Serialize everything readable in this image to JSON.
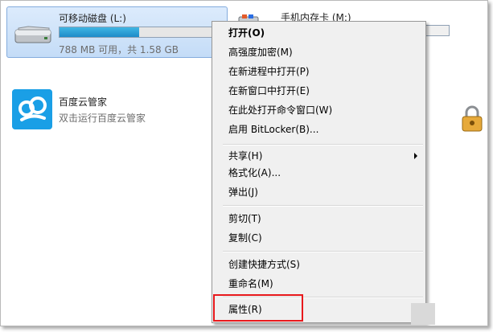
{
  "drive_removable": {
    "name": "可移动磁盘 (L:)",
    "space": "788 MB 可用，共 1.58 GB",
    "used_fraction": 0.5
  },
  "drive_phone": {
    "name": "手机内存卡 (M:)"
  },
  "baidu": {
    "name": "百度云管家",
    "description": "双击运行百度云管家"
  },
  "menu": {
    "open": "打开(O)",
    "encrypt": "高强度加密(M)",
    "open_new_process": "在新进程中打开(P)",
    "open_new_window": "在新窗口中打开(E)",
    "open_cmd": "在此处打开命令窗口(W)",
    "bitlocker": "启用 BitLocker(B)...",
    "share": "共享(H)",
    "format": "格式化(A)...",
    "eject": "弹出(J)",
    "cut": "剪切(T)",
    "copy": "复制(C)",
    "create_shortcut": "创建快捷方式(S)",
    "rename": "重命名(M)",
    "properties": "属性(R)"
  },
  "colors": {
    "highlight": "#e8191c",
    "bar_fill": "#26a0da",
    "baidu_blue": "#1a9fe6"
  }
}
